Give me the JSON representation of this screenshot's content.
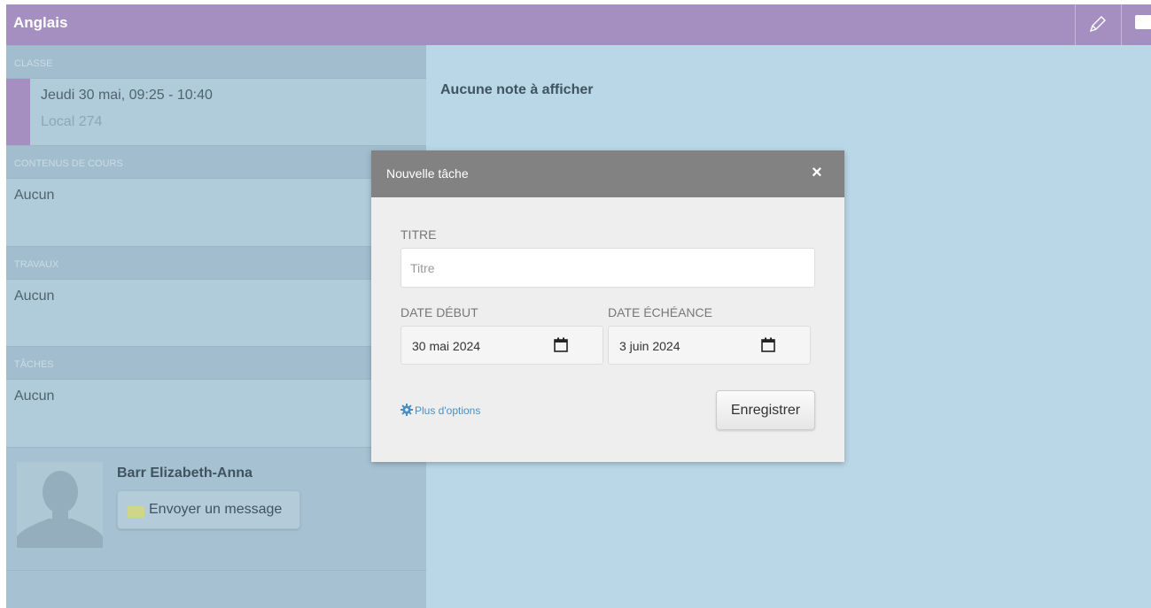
{
  "header": {
    "title": "Anglais",
    "icons": [
      "pencil-icon",
      "folder-icon"
    ]
  },
  "sidebar": {
    "class_section": {
      "label": "CLASSE",
      "time": "Jeudi 30 mai, 09:25 - 10:40",
      "room": "Local 274"
    },
    "content_section": {
      "label": "CONTENUS DE COURS",
      "value": "Aucun"
    },
    "work_section": {
      "label": "TRAVAUX",
      "value": "Aucun"
    },
    "tasks_section": {
      "label": "TÂCHES",
      "value": "Aucun"
    },
    "teacher": {
      "name": "Barr Elizabeth-Anna",
      "message_button": "Envoyer un message"
    }
  },
  "main": {
    "empty_notes": "Aucune note à afficher"
  },
  "modal": {
    "title": "Nouvelle tâche",
    "close": "×",
    "title_label": "TITRE",
    "title_placeholder": "Titre",
    "start_label": "DATE DÉBUT",
    "start_value": "30 mai 2024",
    "due_label": "DATE ÉCHÉANCE",
    "due_value": "3 juin 2024",
    "more_options": "Plus d'options",
    "save": "Enregistrer"
  },
  "colors": {
    "header": "#a58ec0",
    "background": "#b9d7e6",
    "modal_header": "#828282",
    "link": "#4a8fc2"
  }
}
